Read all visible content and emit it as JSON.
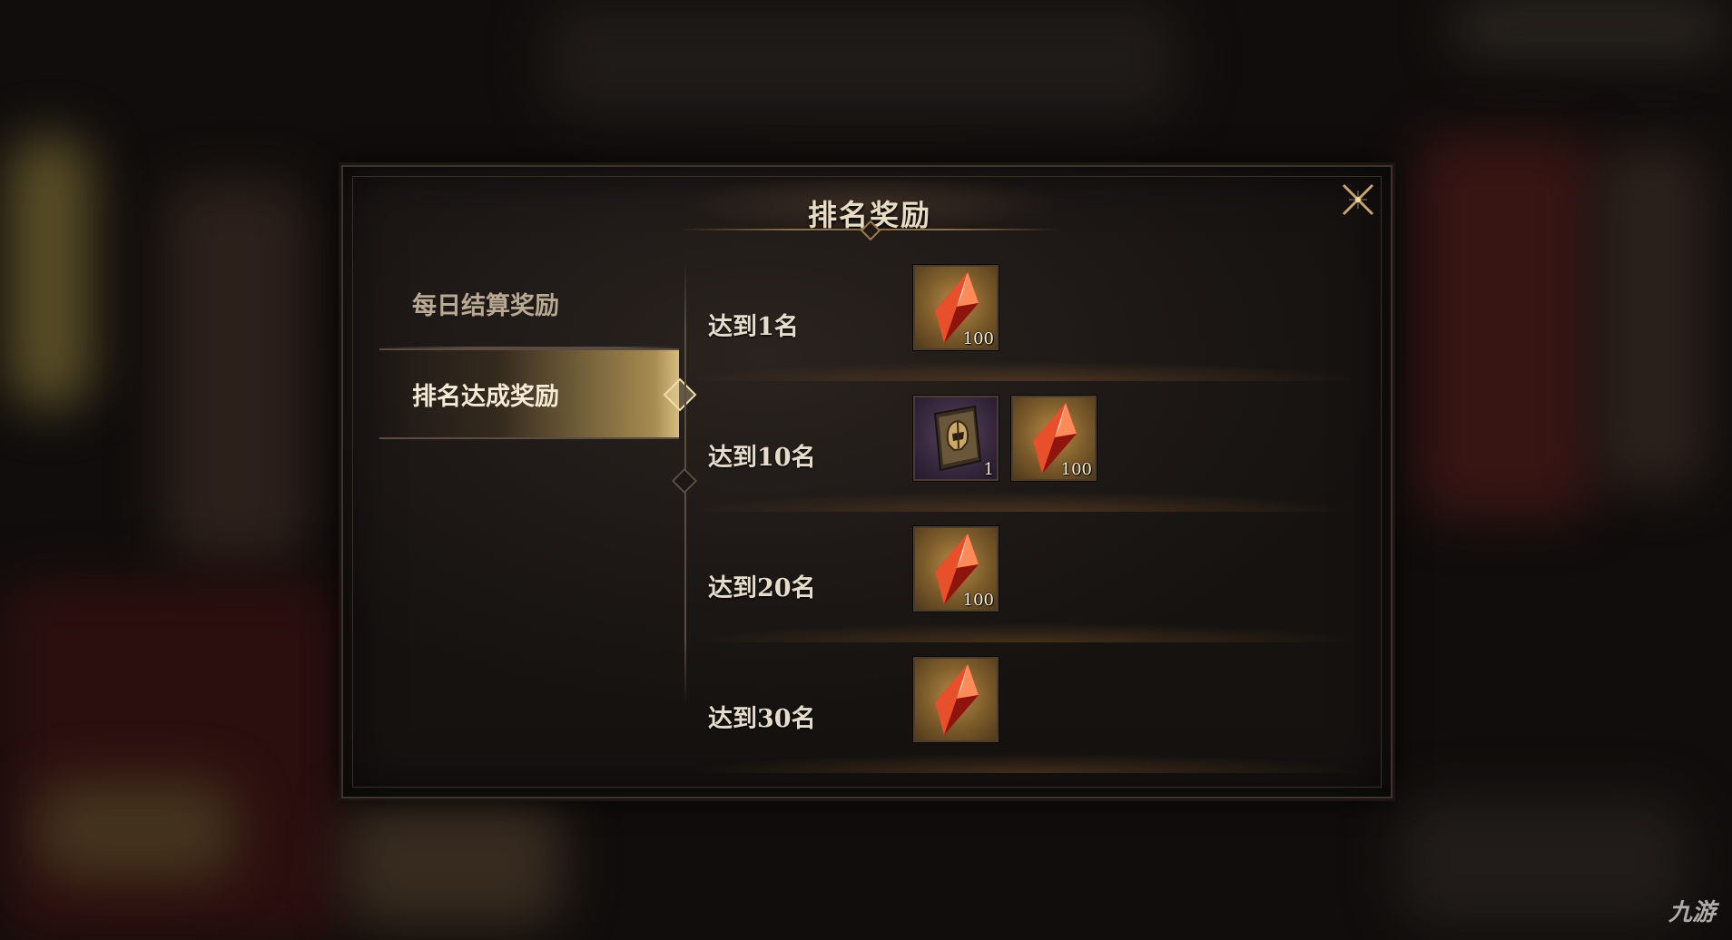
{
  "dialog": {
    "title": "排名奖励",
    "close_icon": "close-x-icon"
  },
  "tabs": [
    {
      "label": "每日结算奖励",
      "active": false
    },
    {
      "label": "排名达成奖励",
      "active": true
    }
  ],
  "rewards": [
    {
      "label": "达到1名",
      "items": [
        {
          "icon": "red-crystal-icon",
          "count": "100"
        }
      ]
    },
    {
      "label": "达到10名",
      "items": [
        {
          "icon": "helmet-tome-icon",
          "count": "1"
        },
        {
          "icon": "red-crystal-icon",
          "count": "100"
        }
      ]
    },
    {
      "label": "达到20名",
      "items": [
        {
          "icon": "red-crystal-icon",
          "count": "100"
        }
      ]
    },
    {
      "label": "达到30名",
      "items": [
        {
          "icon": "red-crystal-icon",
          "count": ""
        }
      ]
    }
  ],
  "watermark": "九游",
  "colors": {
    "accent_gold": "#d6bd80",
    "panel": "#1d1816",
    "text": "#e6dccb"
  }
}
